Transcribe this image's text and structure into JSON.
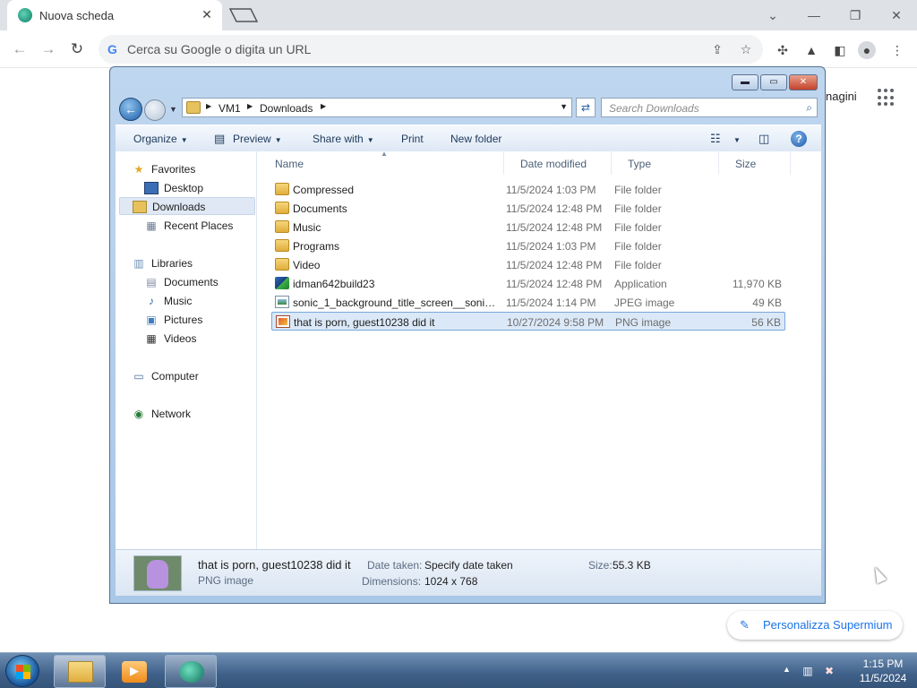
{
  "browser": {
    "tab_title": "Nuova scheda",
    "omnibox_placeholder": "Cerca su Google o digita un URL",
    "page_partial_text": "nagini",
    "customize_label": "Personalizza Supermium"
  },
  "explorer": {
    "breadcrumb": [
      "VM1",
      "Downloads"
    ],
    "search_placeholder": "Search Downloads",
    "commands": {
      "organize": "Organize",
      "preview": "Preview",
      "share_with": "Share with",
      "print": "Print",
      "new_folder": "New folder"
    },
    "nav": {
      "favorites_header": "Favorites",
      "favorites": [
        "Desktop",
        "Downloads",
        "Recent Places"
      ],
      "libraries_header": "Libraries",
      "libraries": [
        "Documents",
        "Music",
        "Pictures",
        "Videos"
      ],
      "computer": "Computer",
      "network": "Network"
    },
    "columns": {
      "name": "Name",
      "date": "Date modified",
      "type": "Type",
      "size": "Size"
    },
    "files": [
      {
        "name": "Compressed",
        "date": "11/5/2024 1:03 PM",
        "type": "File folder",
        "size": "",
        "icon": "folder-icon"
      },
      {
        "name": "Documents",
        "date": "11/5/2024 12:48 PM",
        "type": "File folder",
        "size": "",
        "icon": "folder-icon"
      },
      {
        "name": "Music",
        "date": "11/5/2024 12:48 PM",
        "type": "File folder",
        "size": "",
        "icon": "folder-icon"
      },
      {
        "name": "Programs",
        "date": "11/5/2024 1:03 PM",
        "type": "File folder",
        "size": "",
        "icon": "folder-icon"
      },
      {
        "name": "Video",
        "date": "11/5/2024 12:48 PM",
        "type": "File folder",
        "size": "",
        "icon": "folder-icon"
      },
      {
        "name": "idman642build23",
        "date": "11/5/2024 12:48 PM",
        "type": "Application",
        "size": "11,970 KB",
        "icon": "application-icon"
      },
      {
        "name": "sonic_1_background_title_screen__sonicd...",
        "date": "11/5/2024 1:14 PM",
        "type": "JPEG image",
        "size": "49 KB",
        "icon": "jpeg-image-icon"
      },
      {
        "name": "that is porn, guest10238 did it",
        "date": "10/27/2024 9:58 PM",
        "type": "PNG image",
        "size": "56 KB",
        "icon": "png-image-icon"
      }
    ],
    "selected_index": 7,
    "details": {
      "name": "that is porn, guest10238 did it",
      "type": "PNG image",
      "date_taken_label": "Date taken:",
      "date_taken_value": "Specify date taken",
      "dimensions_label": "Dimensions:",
      "dimensions_value": "1024 x 768",
      "size_label": "Size:",
      "size_value": "55.3 KB"
    }
  },
  "taskbar": {
    "time": "1:15 PM",
    "date": "11/5/2024"
  }
}
